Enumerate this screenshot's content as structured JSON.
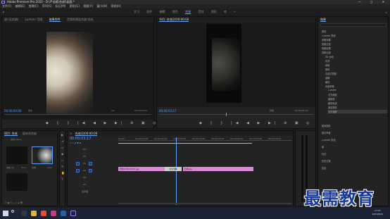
{
  "app": {
    "title": "Adobe Premiere Pro 2020 - D:\\严龙姬\\合成\\\\画面 *",
    "window_controls": "— ◻ ✕"
  },
  "menu": [
    "文件(F)",
    "编辑(E)",
    "剪辑(C)",
    "序列(S)",
    "标记(M)",
    "图形(G)",
    "视图(V)",
    "窗口(W)",
    "帮助(H)"
  ],
  "workspaces": [
    "学习",
    "组件",
    "编辑",
    "颜色",
    "效果",
    "音频",
    "图形",
    "库"
  ],
  "workspace_active_index": 4,
  "source": {
    "tabs": [
      "源:(无剪辑)",
      "Lumetri 范围",
      "效果控件",
      "音频剪辑混合器:合成"
    ],
    "active_tab": 2,
    "timecode_left": "00;00;00;00",
    "fit": "适合",
    "ratio": "1/2",
    "timecode_right": "00;00;03;00"
  },
  "program": {
    "tab": "节目: 合成(2)00:00:00",
    "timecode_left": "00;00;03;17",
    "fit": "完整",
    "timecode_right": "00;00;04;14"
  },
  "effects": {
    "title": "效果",
    "items": [
      "预设",
      "Lumetri 预设",
      "音频效果",
      "音频过渡",
      "视频效果",
      "视频过渡",
      "3D 运动",
      "内滑",
      "划像",
      "擦除",
      "沉浸式视频",
      "溶解",
      "缩放",
      "页面剥落",
      "Lumetri",
      "交叉缩放",
      "缩放框",
      "缩放轨道",
      "渐变擦除",
      "交叉溶解"
    ],
    "bottom": [
      "基本图形",
      "基本声音",
      "Lumetri 颜色",
      "库",
      "标记",
      "历史记录",
      "信息"
    ]
  },
  "project": {
    "tabs": [
      "项目: 合成",
      "媒体浏览器"
    ],
    "file": "合成.prproj",
    "items": [
      {
        "name": "合成 (2)",
        "duration": "4;14"
      },
      {
        "name": "合成",
        "duration": "4;14"
      }
    ]
  },
  "timeline": {
    "tab": "合成(2)00:00:00",
    "timecode": "00;00;03;17",
    "ruler": [
      "00;00",
      "00;00;01;00",
      "00;00;02;00",
      "00;00;03;00",
      "00;00;04;00",
      "00;00;05;00",
      "00;00;06;00",
      "00;00;07;00",
      "00;00;08;00"
    ],
    "tracks": [
      "V3",
      "V2",
      "V1",
      "A1",
      "A2",
      "A3",
      "主声道"
    ],
    "clips": [
      {
        "label": "合成(2)00:00:00.jpg"
      },
      {
        "label": "交叉溶解"
      },
      {
        "label": "合成.jpg"
      }
    ]
  },
  "taskbar": {
    "time": "17:57",
    "date": "2021/8/29"
  },
  "watermark": "最需教育",
  "colors": {
    "accent": "#5aa0ff",
    "clip": "#d98ad6",
    "panel": "#232323"
  }
}
